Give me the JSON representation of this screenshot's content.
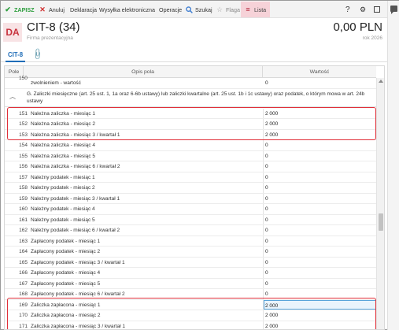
{
  "toolbar": {
    "save": "ZAPISZ",
    "cancel": "Anuluj",
    "declaration": "Deklaracja",
    "send": "Wysyłka elektroniczna",
    "operations": "Operacje",
    "search": "Szukaj",
    "flag": "Flaga",
    "list": "Lista",
    "help": "?"
  },
  "header": {
    "logo": "DA",
    "title": "CIT-8 (34)",
    "subtitle": "Firma prezentacyjna",
    "amount": "0,00 PLN",
    "year": "rok 2026"
  },
  "tabs": {
    "active": "CIT-8"
  },
  "grid": {
    "columns": [
      "Pole",
      "Opis pola",
      "Wartość"
    ],
    "partial_row": {
      "num": "150",
      "desc": "zwolnieniem - wartość",
      "value": "0"
    },
    "group_label": "G. Zaliczki miesięczne (art. 25 ust. 1, 1a oraz 6-6b ustawy) lub zaliczki kwartalne (art. 25 ust. 1b i 1c ustawy) oraz podatek, o którym mowa w art. 24b ustawy",
    "rows": [
      {
        "num": "151",
        "desc": "Należna zaliczka - miesiąc 1",
        "value": "2 000"
      },
      {
        "num": "152",
        "desc": "Należna zaliczka - miesiąc 2",
        "value": "2 000"
      },
      {
        "num": "153",
        "desc": "Należna zaliczka - miesiąc 3 / kwartał 1",
        "value": "2 000"
      },
      {
        "num": "154",
        "desc": "Należna zaliczka - miesiąc 4",
        "value": "0"
      },
      {
        "num": "155",
        "desc": "Należna zaliczka - miesiąc 5",
        "value": "0"
      },
      {
        "num": "156",
        "desc": "Należna zaliczka - miesiąc 6 / kwartał 2",
        "value": "0"
      },
      {
        "num": "157",
        "desc": "Należny podatek - miesiąc 1",
        "value": "0"
      },
      {
        "num": "158",
        "desc": "Należny podatek - miesiąc 2",
        "value": "0"
      },
      {
        "num": "159",
        "desc": "Należny podatek - miesiąc 3 / kwartał 1",
        "value": "0"
      },
      {
        "num": "160",
        "desc": "Należny podatek - miesiąc 4",
        "value": "0"
      },
      {
        "num": "161",
        "desc": "Należny podatek - miesiąc 5",
        "value": "0"
      },
      {
        "num": "162",
        "desc": "Należny podatek - miesiąc 6 / kwartał 2",
        "value": "0"
      },
      {
        "num": "163",
        "desc": "Zapłacony podatek - miesiąc 1",
        "value": "0"
      },
      {
        "num": "164",
        "desc": "Zapłacony podatek - miesiąc 2",
        "value": "0"
      },
      {
        "num": "165",
        "desc": "Zapłacony podatek - miesiąc 3 / kwartał 1",
        "value": "0"
      },
      {
        "num": "166",
        "desc": "Zapłacony podatek - miesiąc 4",
        "value": "0"
      },
      {
        "num": "167",
        "desc": "Zapłacony podatek - miesiąc 5",
        "value": "0"
      },
      {
        "num": "168",
        "desc": "Zapłacony podatek - miesiąc 6 / kwartał 2",
        "value": "0"
      },
      {
        "num": "169",
        "desc": "Zaliczka zapłacona - miesiąc 1",
        "value": "2 000"
      },
      {
        "num": "170",
        "desc": "Zaliczka zapłacona - miesiąc 2",
        "value": "2 000"
      },
      {
        "num": "171",
        "desc": "Zaliczka zapłacona - miesiąc 3 / kwartał 1",
        "value": "2 000"
      }
    ]
  },
  "colors": {
    "accent": "#1f6db8",
    "save": "#2e9e3e",
    "cancel": "#d03030",
    "highlight": "#e0303a",
    "list_bg": "#f6d2d8"
  }
}
